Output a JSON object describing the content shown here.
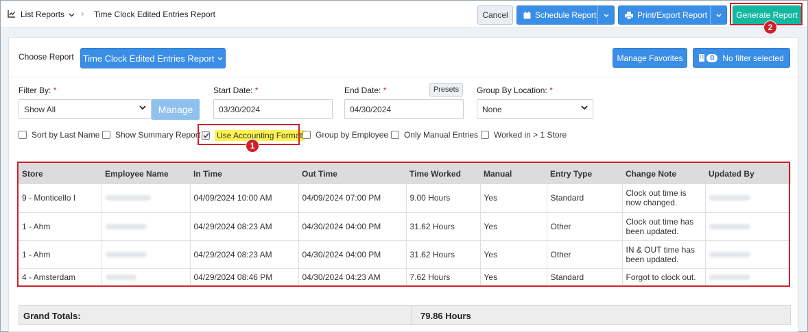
{
  "breadcrumb": {
    "list_reports": "List Reports",
    "current": "Time Clock Edited Entries Report"
  },
  "toolbar": {
    "cancel": "Cancel",
    "schedule": "Schedule Report",
    "print_export": "Print/Export Report",
    "generate": "Generate Report"
  },
  "callouts": {
    "one": "1",
    "two": "2"
  },
  "choose_report": {
    "label": "Choose Report",
    "selected": "Time Clock Edited Entries Report"
  },
  "manage_favorites": "Manage Favorites",
  "filter_badge": {
    "count": "0",
    "label": "No filter selected"
  },
  "filters": {
    "filter_by_label": "Filter By:",
    "filter_by_value": "Show All",
    "manage": "Manage",
    "start_label": "Start Date:",
    "start_value": "03/30/2024",
    "end_label": "End Date:",
    "end_value": "04/30/2024",
    "presets": "Presets",
    "group_location_label": "Group By Location:",
    "group_location_value": "None",
    "required_mark": "*"
  },
  "options": [
    {
      "label": "Sort by Last Name",
      "checked": false
    },
    {
      "label": "Show Summary Report",
      "checked": false
    },
    {
      "label": "Use Accounting Format",
      "checked": true
    },
    {
      "label": "Group by Employee",
      "checked": false
    },
    {
      "label": "Only Manual Entries",
      "checked": false
    },
    {
      "label": "Worked in > 1 Store",
      "checked": false
    }
  ],
  "table": {
    "headers": [
      "Store",
      "Employee Name",
      "In Time",
      "Out Time",
      "Time Worked",
      "Manual",
      "Entry Type",
      "Change Note",
      "Updated By"
    ],
    "rows": [
      {
        "store": "9 - Monticello I",
        "in": "04/09/2024 10:00 AM",
        "out": "04/09/2024 07:00 PM",
        "worked": "9.00 Hours",
        "manual": "Yes",
        "type": "Standard",
        "note": "Clock out time is now changed."
      },
      {
        "store": "1 - Ahm",
        "in": "04/29/2024 08:23 AM",
        "out": "04/30/2024 04:00 PM",
        "worked": "31.62 Hours",
        "manual": "Yes",
        "type": "Other",
        "note": "Clock out time has been updated."
      },
      {
        "store": "1 - Ahm",
        "in": "04/29/2024 08:23 AM",
        "out": "04/30/2024 04:00 PM",
        "worked": "31.62 Hours",
        "manual": "Yes",
        "type": "Other",
        "note": "IN & OUT time has been updated."
      },
      {
        "store": "4 - Amsterdam",
        "in": "04/29/2024 08:46 PM",
        "out": "04/30/2024 04:23 AM",
        "worked": "7.62 Hours",
        "manual": "Yes",
        "type": "Standard",
        "note": "Forgot to clock out."
      }
    ]
  },
  "totals": {
    "label": "Grand Totals:",
    "value": "79.86 Hours"
  }
}
